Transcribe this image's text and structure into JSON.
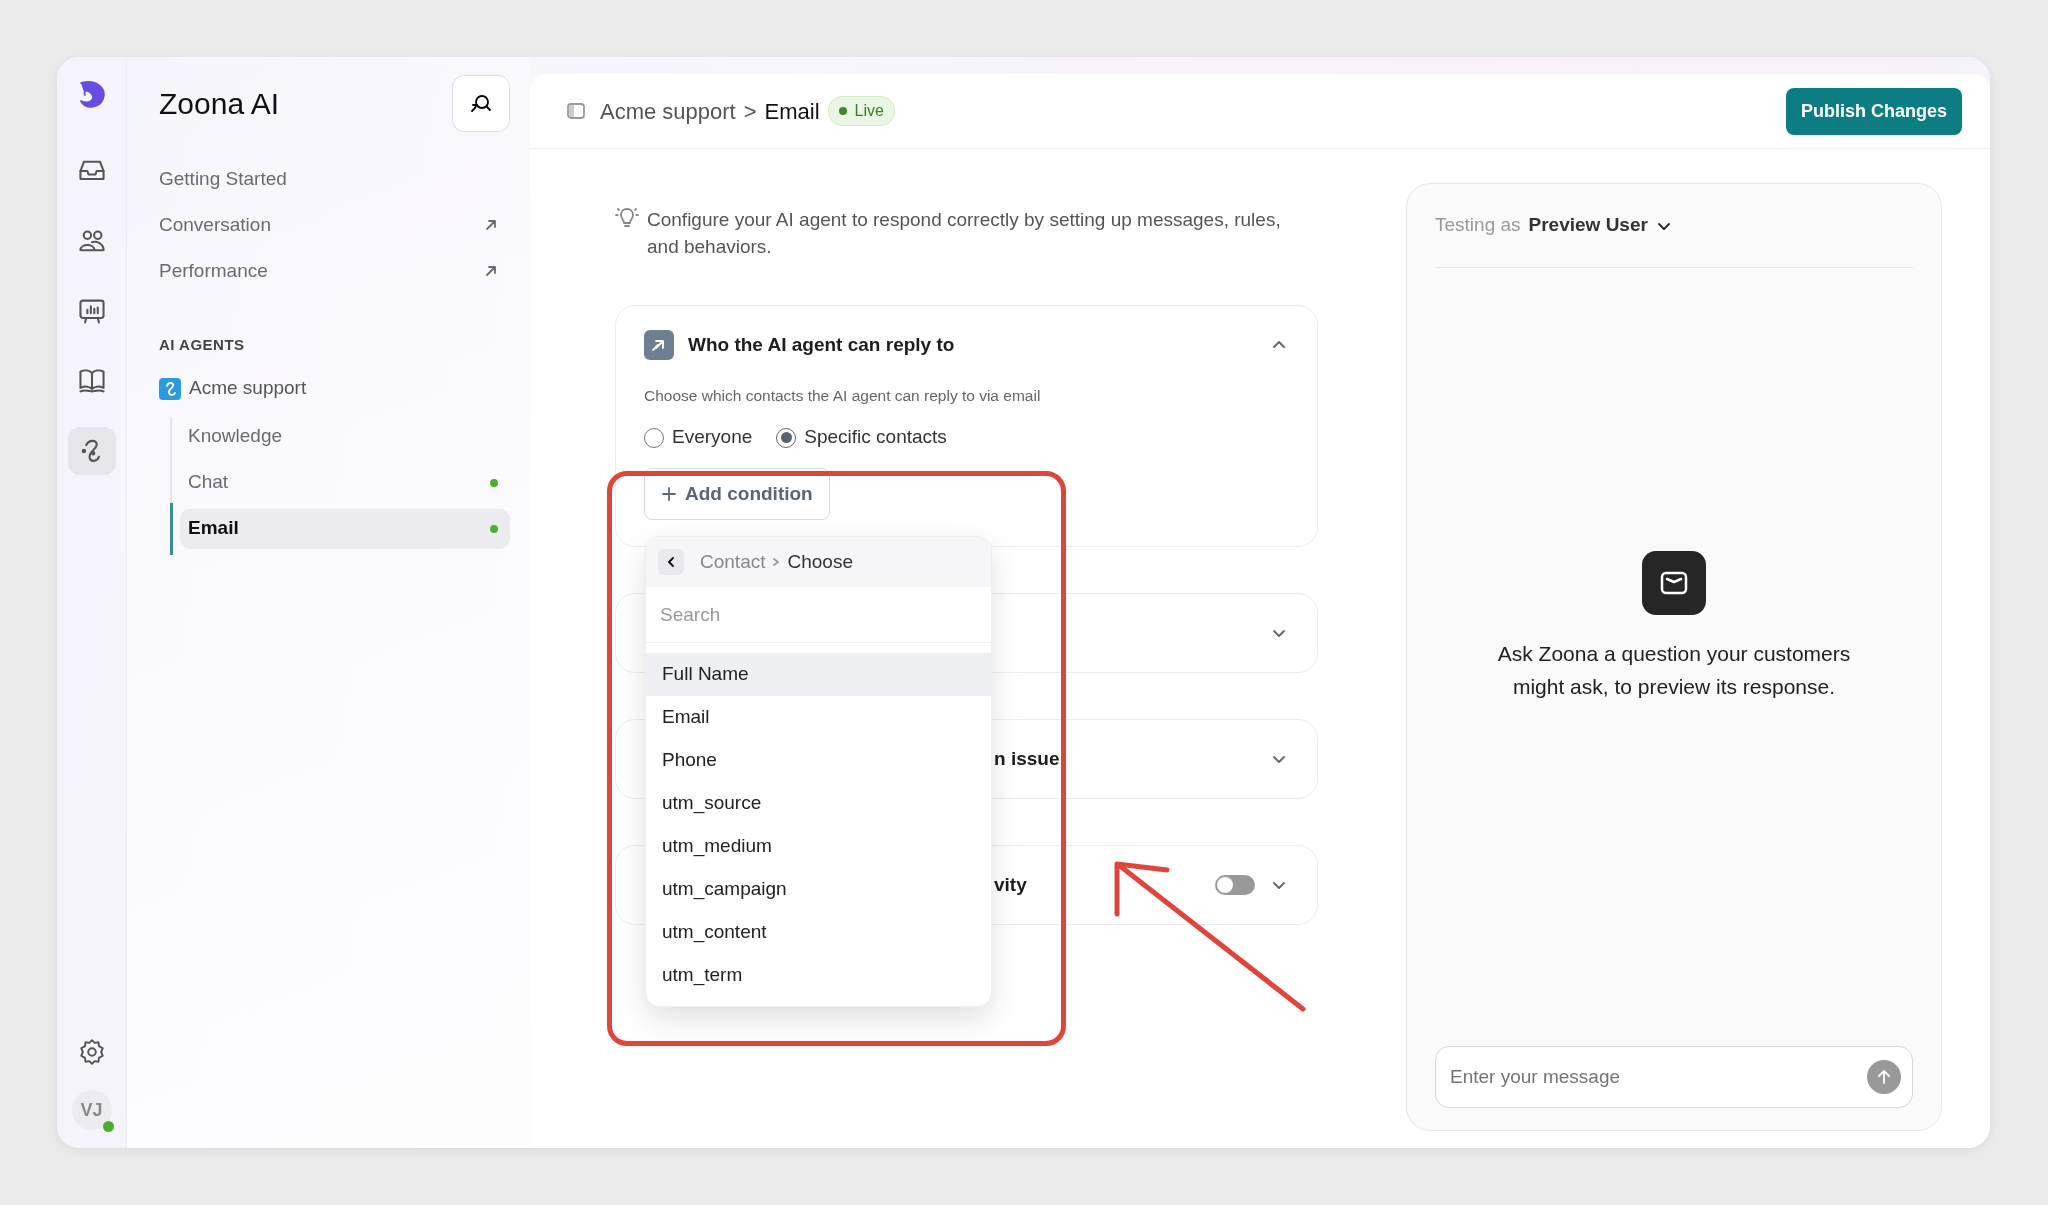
{
  "rail": [
    {
      "selected": false
    },
    {
      "selected": false
    },
    {
      "selected": false
    },
    {
      "selected": false
    },
    {
      "selected": true
    }
  ],
  "avatar": {
    "initials": "VJ",
    "online": true
  },
  "app_title": "Zoona AI",
  "nav": [
    {
      "label": "Getting Started",
      "external": false
    },
    {
      "label": "Conversation",
      "external": true
    },
    {
      "label": "Performance",
      "external": true
    }
  ],
  "section_label": "AI AGENTS",
  "agent": {
    "name": "Acme support",
    "children": [
      {
        "label": "Knowledge",
        "selected": false,
        "live": false
      },
      {
        "label": "Chat",
        "selected": false,
        "live": true
      },
      {
        "label": "Email",
        "selected": true,
        "live": true
      }
    ]
  },
  "header": {
    "breadcrumb": [
      "Acme support",
      "Email"
    ],
    "separator": ">",
    "status": "Live",
    "publish": "Publish Changes"
  },
  "intro": "Configure your AI agent to respond correctly by setting up messages, rules, and behaviors.",
  "cards": [
    {
      "kind": "audience",
      "title": "Who the AI agent can reply to",
      "expanded": true,
      "subtitle": "Choose which contacts the AI agent can reply to via email",
      "options": [
        {
          "label": "Everyone",
          "selected": false
        },
        {
          "label": "Specific contacts",
          "selected": true
        }
      ],
      "add_button": "Add condition"
    },
    {
      "kind": "plain",
      "expanded": false
    },
    {
      "kind": "plain",
      "title": "n issue",
      "expanded": false
    },
    {
      "kind": "toggle",
      "title": "vity",
      "on": false,
      "expanded": false
    }
  ],
  "dropdown": {
    "breadcrumb": [
      "Contact",
      "Choose"
    ],
    "search": {
      "placeholder": "Search"
    },
    "items": [
      {
        "label": "Full Name",
        "highlighted": true
      },
      {
        "label": "Email",
        "highlighted": false
      },
      {
        "label": "Phone",
        "highlighted": false
      },
      {
        "label": "utm_source",
        "highlighted": false
      },
      {
        "label": "utm_medium",
        "highlighted": false
      },
      {
        "label": "utm_campaign",
        "highlighted": false
      },
      {
        "label": "utm_content",
        "highlighted": false
      },
      {
        "label": "utm_term",
        "highlighted": false
      }
    ]
  },
  "preview": {
    "testing_label": "Testing as",
    "user": "Preview User",
    "prompt": "Ask Zoona a question your customers might ask, to preview its response.",
    "message": {
      "placeholder": "Enter your message"
    }
  }
}
